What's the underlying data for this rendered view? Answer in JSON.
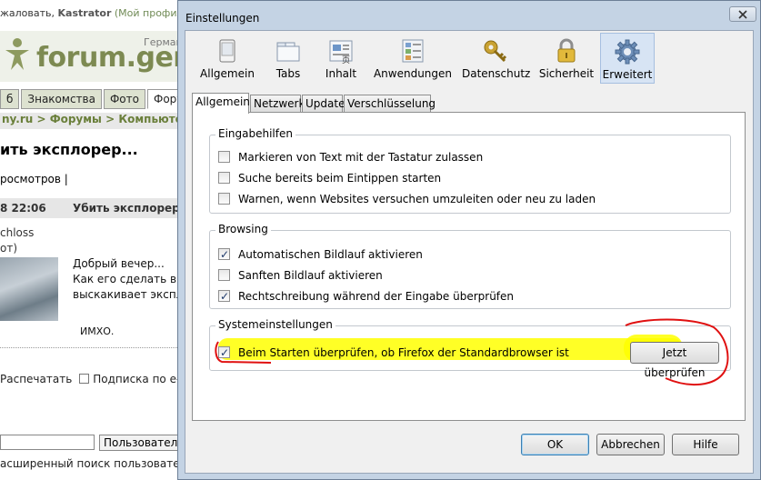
{
  "background": {
    "topbar": {
      "greeting": "жаловать,",
      "user": "Kastrator",
      "profile": "(Мой профиль"
    },
    "logo": {
      "text": "forum.germa",
      "small": "Герман"
    },
    "tabs": [
      {
        "label": "б"
      },
      {
        "label": "Знакомства"
      },
      {
        "label": "Фото"
      },
      {
        "label": "Форумы"
      }
    ],
    "breadcrumb": "ny.ru > Форумы > Компьютер",
    "topic_title": "ить эксплорер...",
    "views": "росмотров |",
    "post": {
      "time": "8 22:06",
      "subject": "Убить эксплорер."
    },
    "author": "chloss",
    "author_role": "от)",
    "message_lines": [
      "Добрый вечер...",
      "Как его сделать в В",
      "выскакивает экспло"
    ],
    "message_sig": "ИМХО.",
    "actions": {
      "print": "Распечатать",
      "subscribe": "Подписка по e-ma"
    },
    "search_select": "Пользователя",
    "extended_search": "асширенный поиск пользователей"
  },
  "dialog": {
    "title": "Einstellungen",
    "toolbar": [
      {
        "label": "Allgemein",
        "icon": "switch-panel-icon"
      },
      {
        "label": "Tabs",
        "icon": "tabs-icon"
      },
      {
        "label": "Inhalt",
        "icon": "content-icon"
      },
      {
        "label": "Anwendungen",
        "icon": "applications-icon"
      },
      {
        "label": "Datenschutz",
        "icon": "privacy-key-icon"
      },
      {
        "label": "Sicherheit",
        "icon": "padlock-icon"
      },
      {
        "label": "Erweitert",
        "icon": "gear-icon"
      }
    ],
    "selected_toolbar": "Erweitert",
    "subtabs": [
      "Allgemein",
      "Netzwerk",
      "Update",
      "Verschlüsselung"
    ],
    "active_subtab": "Allgemein",
    "groups": {
      "eingabehilfen": {
        "legend": "Eingabehilfen",
        "items": [
          {
            "label": "Markieren von Text mit der Tastatur zulassen",
            "checked": false
          },
          {
            "label": "Suche bereits beim Eintippen starten",
            "checked": false
          },
          {
            "label": "Warnen, wenn Websites versuchen umzuleiten oder neu zu laden",
            "checked": false
          }
        ]
      },
      "browsing": {
        "legend": "Browsing",
        "items": [
          {
            "label": "Automatischen Bildlauf aktivieren",
            "checked": true
          },
          {
            "label": "Sanften Bildlauf aktivieren",
            "checked": false
          },
          {
            "label": "Rechtschreibung während der Eingabe überprüfen",
            "checked": true
          }
        ]
      },
      "system": {
        "legend": "Systemeinstellungen",
        "items": [
          {
            "label": "Beim Starten überprüfen, ob Firefox der Standardbrowser ist",
            "checked": true
          }
        ],
        "check_now_button": "Jetzt überprüfen"
      }
    },
    "buttons": {
      "ok": "OK",
      "cancel": "Abbrechen",
      "help": "Hilfe"
    }
  },
  "colors": {
    "highlight": "#ffff00",
    "annotation_red": "#e01010",
    "dialog_frame": "#c4d3e4",
    "selected_tab": "#d7e4f4"
  }
}
